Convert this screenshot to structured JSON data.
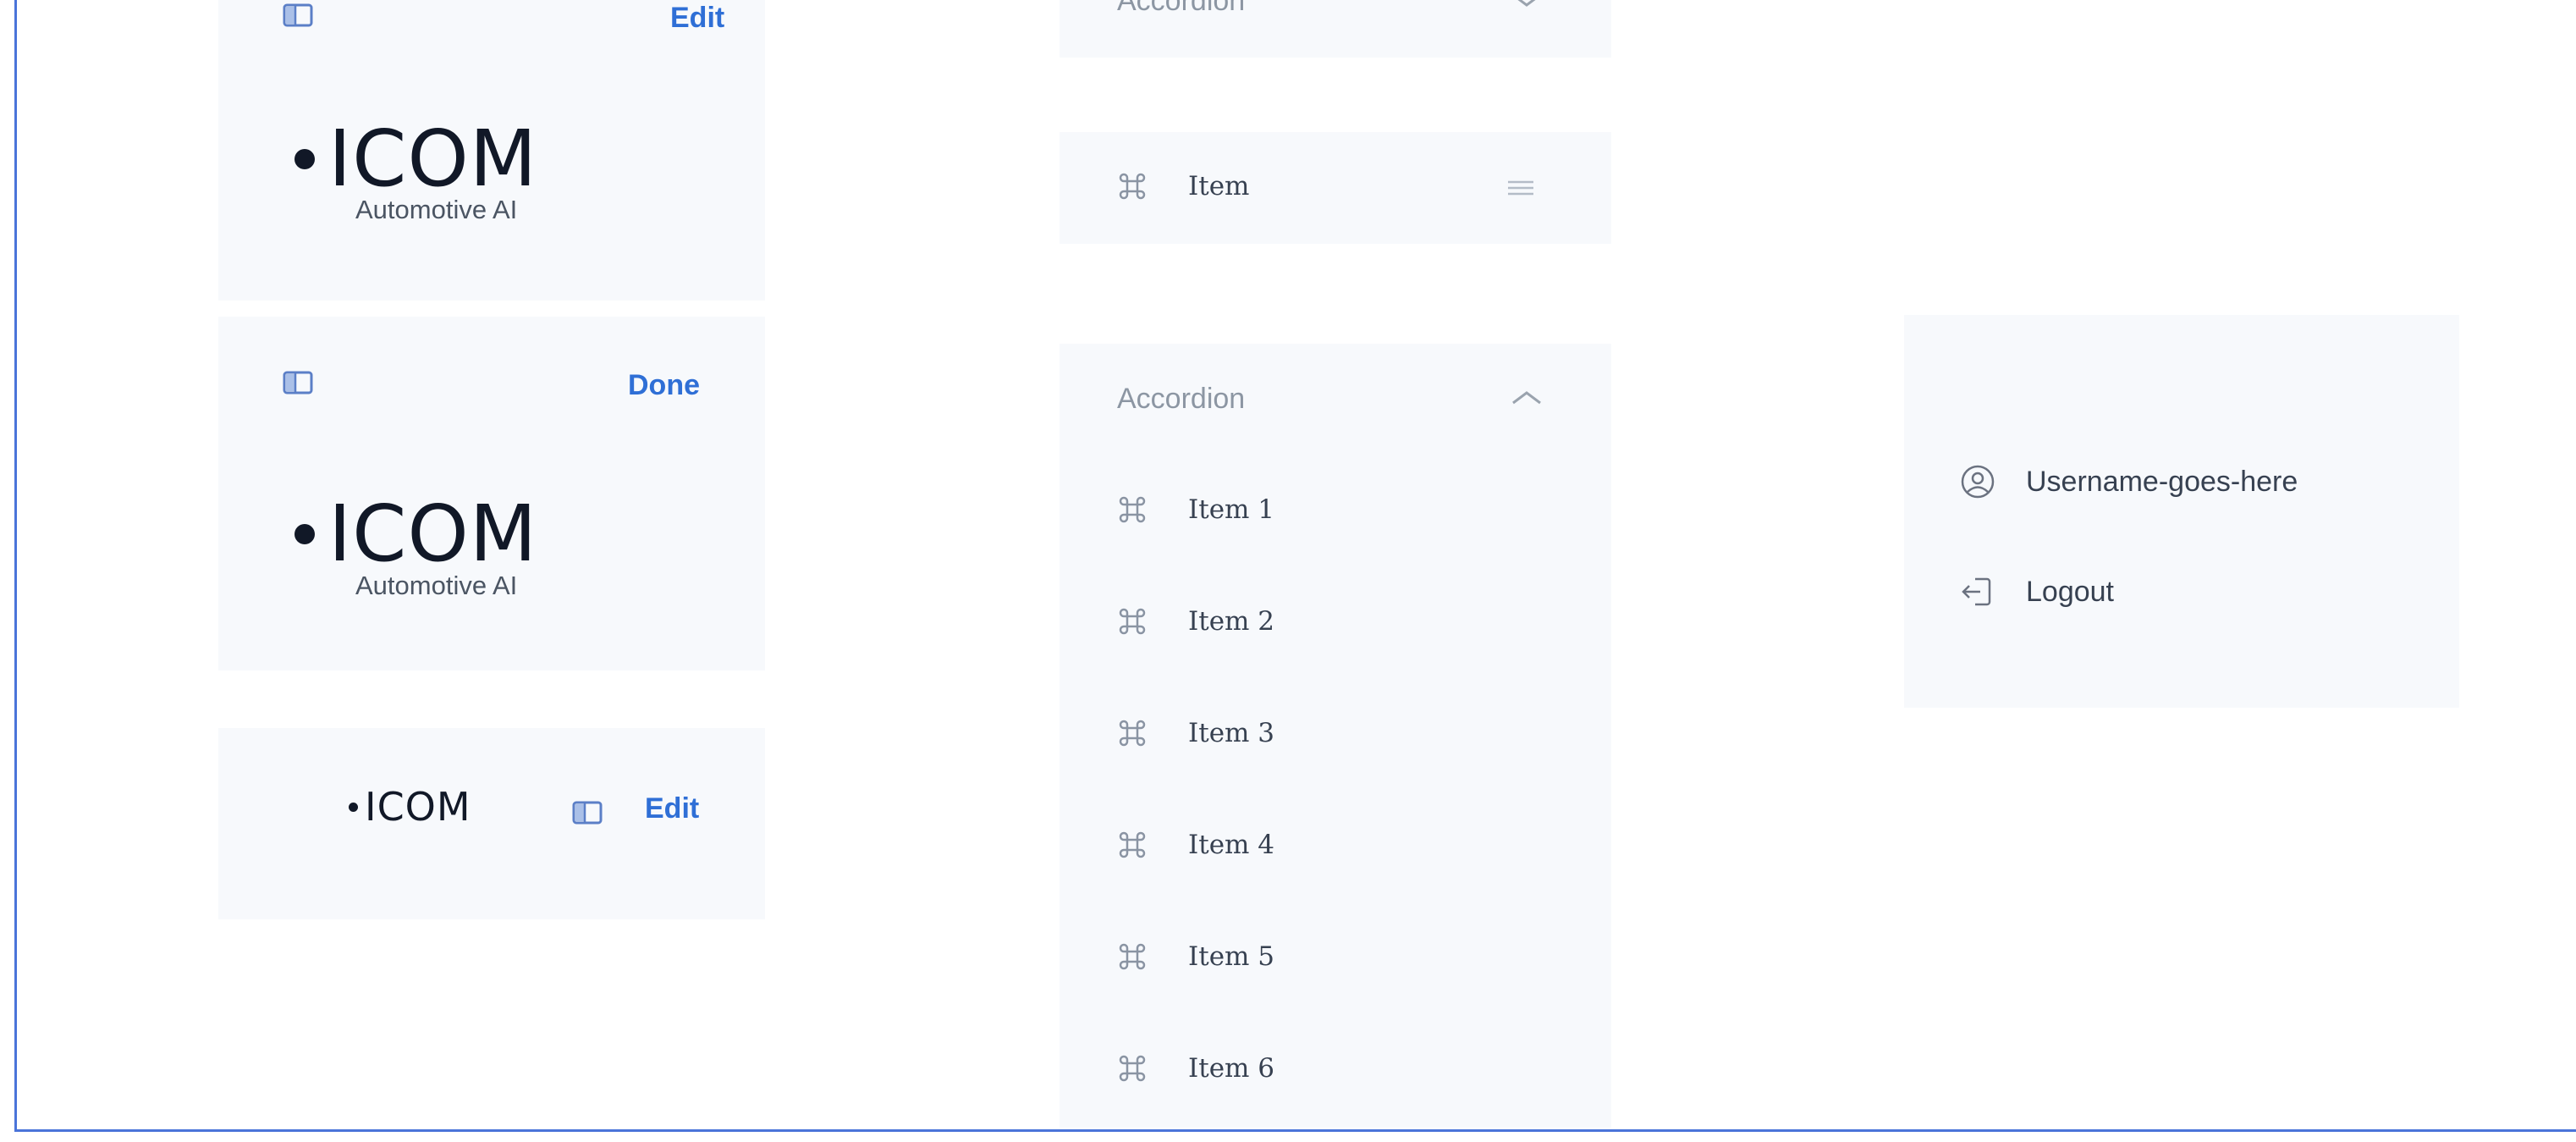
{
  "colors": {
    "accent_blue": "#2f6fd6",
    "panel_bg": "#f7f9fc",
    "frame_border": "#4a74d9",
    "muted_text": "#8c96a3"
  },
  "left_column": {
    "card1": {
      "sidebar_icon": "sidebar-toggle-icon",
      "action_label": "Edit",
      "logo_text": "ICOM",
      "logo_subtitle": "Automotive AI"
    },
    "card2": {
      "sidebar_icon": "sidebar-toggle-icon",
      "action_label": "Done",
      "logo_text": "ICOM",
      "logo_subtitle": "Automotive AI"
    },
    "card3": {
      "logo_text": "ICOM",
      "sidebar_icon": "sidebar-toggle-icon",
      "action_label": "Edit"
    }
  },
  "middle_column": {
    "accordion_collapsed": {
      "label": "Accordion",
      "chevron": "chevron-down-icon"
    },
    "single_item": {
      "icon": "command-icon",
      "label": "Item",
      "handle_icon": "drag-handle-icon"
    },
    "accordion_expanded": {
      "label": "Accordion",
      "chevron": "chevron-up-icon",
      "items": [
        {
          "icon": "command-icon",
          "label": "Item 1"
        },
        {
          "icon": "command-icon",
          "label": "Item 2"
        },
        {
          "icon": "command-icon",
          "label": "Item 3"
        },
        {
          "icon": "command-icon",
          "label": "Item 4"
        },
        {
          "icon": "command-icon",
          "label": "Item 5"
        },
        {
          "icon": "command-icon",
          "label": "Item 6"
        }
      ]
    }
  },
  "user_menu": {
    "username": "Username-goes-here",
    "username_icon": "user-circle-icon",
    "logout_label": "Logout",
    "logout_icon": "logout-icon"
  }
}
